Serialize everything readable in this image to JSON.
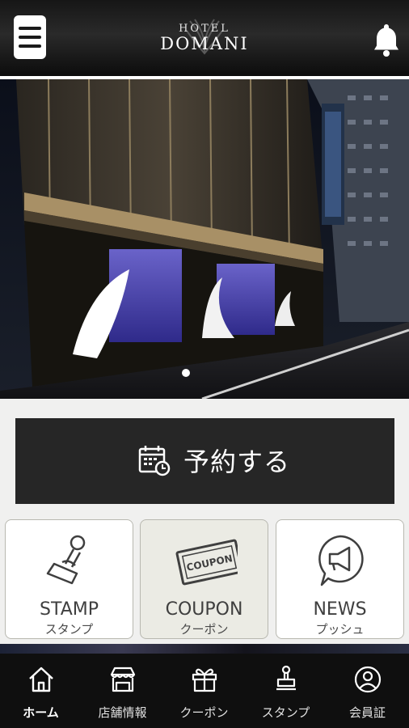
{
  "header": {
    "logo_line1": "HOTEL",
    "logo_line2": "DOMANI",
    "menu_icon": "hamburger-icon",
    "notification_icon": "bell-icon"
  },
  "hero": {
    "image_desc_icon": "hotel-photo",
    "carousel_page": 1,
    "carousel_total": 1
  },
  "reserve": {
    "label": "予約する",
    "icon": "calendar-clock-icon"
  },
  "tiles": [
    {
      "title": "STAMP",
      "subtitle": "スタンプ",
      "icon": "stamp-icon"
    },
    {
      "title": "COUPON",
      "subtitle": "クーポン",
      "icon": "coupon-icon",
      "badge": "COUPON"
    },
    {
      "title": "NEWS",
      "subtitle": "プッシュ",
      "icon": "megaphone-icon"
    }
  ],
  "tabs": [
    {
      "label": "ホーム",
      "icon": "home-icon",
      "active": true
    },
    {
      "label": "店舗情報",
      "icon": "shop-icon",
      "active": false
    },
    {
      "label": "クーポン",
      "icon": "gift-icon",
      "active": false
    },
    {
      "label": "スタンプ",
      "icon": "stamp-icon",
      "active": false
    },
    {
      "label": "会員証",
      "icon": "member-icon",
      "active": false
    }
  ],
  "colors": {
    "header_bg": "#161616",
    "reserve_bg": "#262626",
    "tab_bg": "#0f0f0f",
    "page_bg": "#f0f0ef"
  }
}
